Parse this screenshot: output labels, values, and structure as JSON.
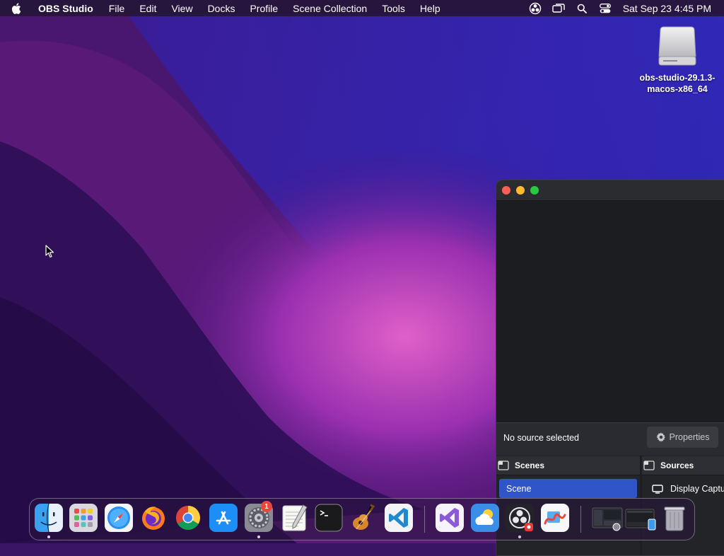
{
  "menubar": {
    "apple_icon": "apple-logo-icon",
    "app_name": "OBS Studio",
    "items": [
      "File",
      "Edit",
      "View",
      "Docks",
      "Profile",
      "Scene Collection",
      "Tools",
      "Help"
    ],
    "status_icons": [
      "obs-status-icon",
      "screen-mirroring-icon",
      "spotlight-search-icon",
      "control-center-icon"
    ],
    "clock": "Sat Sep 23  4:45 PM"
  },
  "desktop": {
    "drive_label_line1": "obs-studio-29.1.3-",
    "drive_label_line2": "macos-x86_64"
  },
  "obs": {
    "no_source_text": "No source selected",
    "properties_label": "Properties",
    "scenes_title": "Scenes",
    "scene_item": "Scene",
    "sources_title": "Sources",
    "source_item": "Display Captu"
  },
  "dock": {
    "apps": [
      "Finder",
      "Launchpad",
      "Safari",
      "Firefox",
      "Google Chrome",
      "App Store",
      "System Settings",
      "TextEdit",
      "Terminal",
      "GarageBand",
      "Visual Studio Code",
      "Visual Studio",
      "Weather",
      "OBS Studio",
      "Freeform",
      "Recent window 1",
      "Recent window 2",
      "Trash"
    ],
    "settings_badge": "1"
  },
  "colors": {
    "accent_blue": "#3055c8",
    "traffic_red": "#ff5f57",
    "traffic_yellow": "#febc2e",
    "traffic_green": "#28c840"
  }
}
